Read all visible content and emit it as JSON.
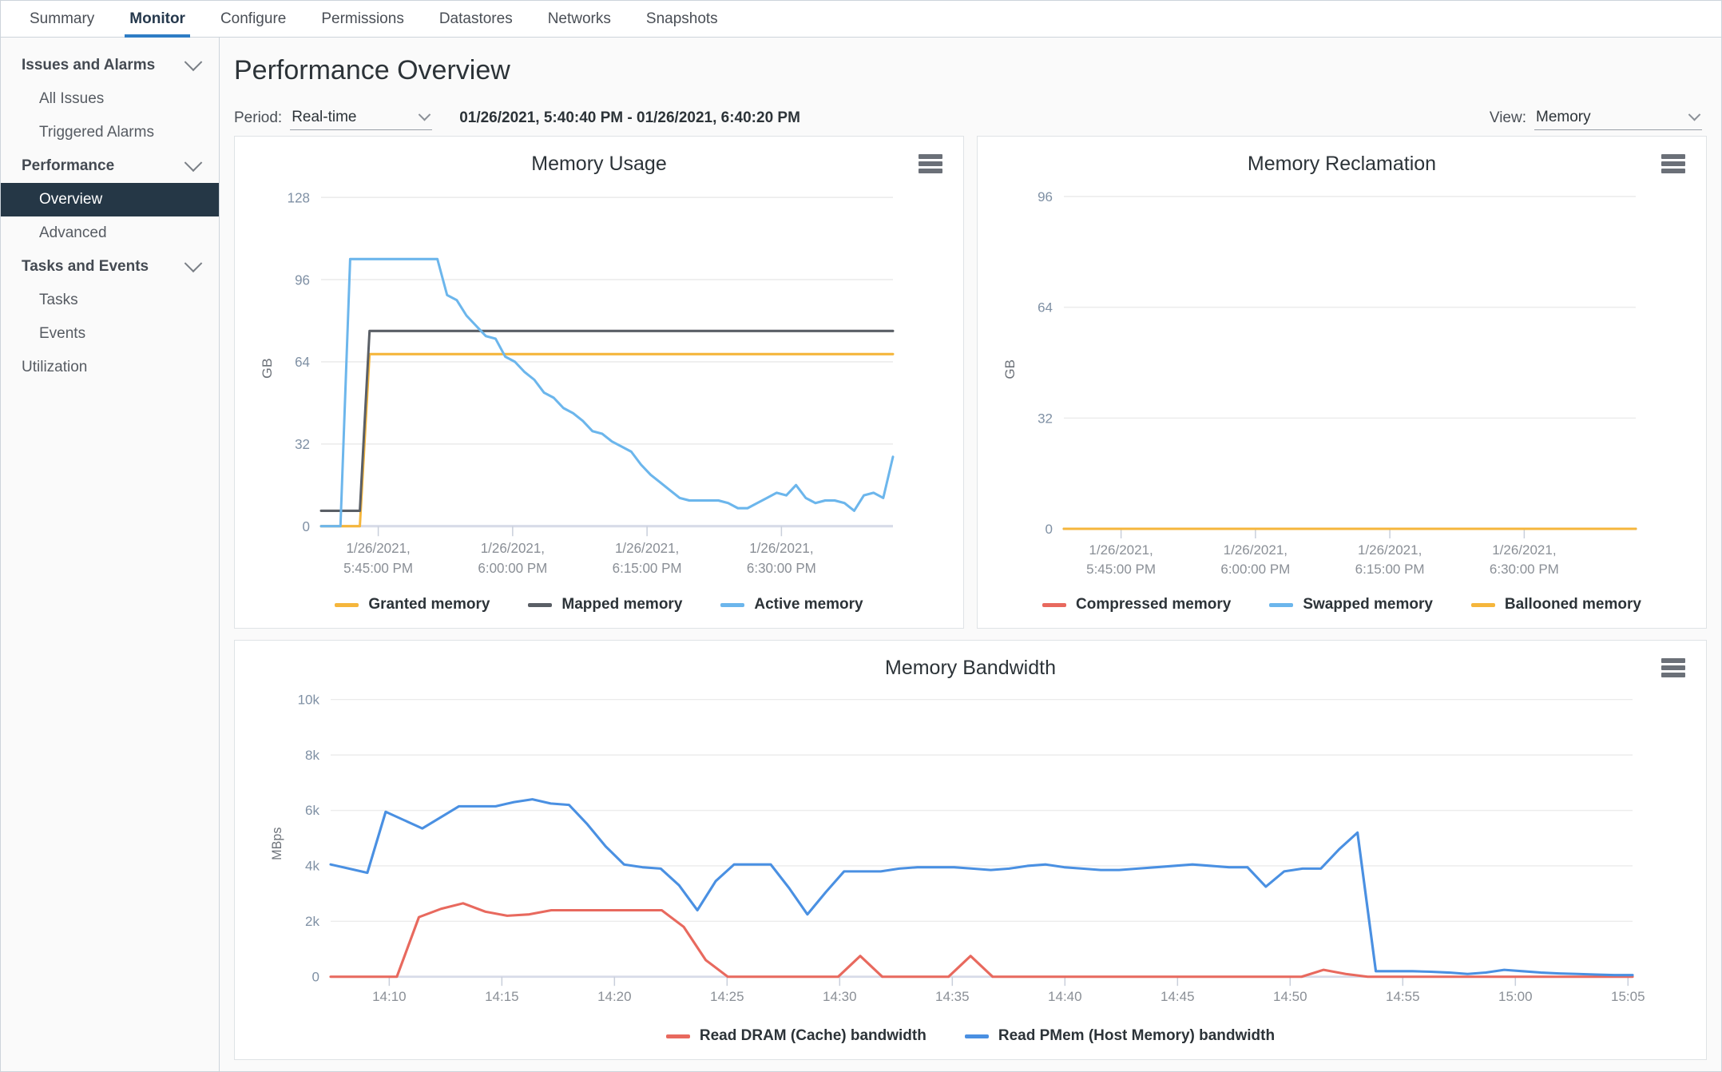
{
  "tabs": [
    {
      "label": "Summary",
      "active": false
    },
    {
      "label": "Monitor",
      "active": true
    },
    {
      "label": "Configure",
      "active": false
    },
    {
      "label": "Permissions",
      "active": false
    },
    {
      "label": "Datastores",
      "active": false
    },
    {
      "label": "Networks",
      "active": false
    },
    {
      "label": "Snapshots",
      "active": false
    }
  ],
  "sidebar": {
    "items": [
      {
        "label": "Issues and Alarms",
        "type": "group",
        "expanded": true
      },
      {
        "label": "All Issues",
        "type": "item"
      },
      {
        "label": "Triggered Alarms",
        "type": "item"
      },
      {
        "label": "Performance",
        "type": "group",
        "expanded": true
      },
      {
        "label": "Overview",
        "type": "item",
        "selected": true
      },
      {
        "label": "Advanced",
        "type": "item"
      },
      {
        "label": "Tasks and Events",
        "type": "group",
        "expanded": true
      },
      {
        "label": "Tasks",
        "type": "item"
      },
      {
        "label": "Events",
        "type": "item"
      },
      {
        "label": "Utilization",
        "type": "item-top"
      }
    ]
  },
  "header": {
    "title": "Performance Overview"
  },
  "controls": {
    "period_label": "Period:",
    "period_value": "Real-time",
    "range_text": "01/26/2021, 5:40:40 PM - 01/26/2021, 6:40:20 PM",
    "view_label": "View:",
    "view_value": "Memory"
  },
  "colors": {
    "granted_memory": "#f5b63c",
    "mapped_memory": "#5a5f66",
    "active_memory": "#6cb6ec",
    "compressed_memory": "#e8695e",
    "swapped_memory": "#6cb6ec",
    "ballooned_memory": "#f5b63c",
    "read_dram": "#e8695e",
    "read_pmem": "#4a90e2",
    "accent": "#2e7dc5",
    "selected_nav": "#253746"
  },
  "chart_data": [
    {
      "type": "line",
      "id": "memory-usage",
      "title": "Memory Usage",
      "xlabel": "",
      "ylabel": "GB",
      "ylim": [
        0,
        128
      ],
      "yticks": [
        0,
        32,
        64,
        96,
        128
      ],
      "ytick_labels": [
        "0",
        "32",
        "64",
        "96",
        "128"
      ],
      "xtick_labels": [
        "1/26/2021,\n5:45:00 PM",
        "1/26/2021,\n6:00:00 PM",
        "1/26/2021,\n6:15:00 PM",
        "1/26/2021,\n6:30:00 PM"
      ],
      "xticks": [
        "1/26/2021, 5:45:00 PM",
        "1/26/2021, 6:00:00 PM",
        "1/26/2021, 6:15:00 PM",
        "1/26/2021, 6:30:00 PM"
      ],
      "grid": true,
      "legend_position": "bottom",
      "series": [
        {
          "name": "Granted memory",
          "color": "#f5b63c",
          "values": [
            0,
            0,
            0,
            0,
            0,
            67,
            67,
            67,
            67,
            67,
            67,
            67,
            67,
            67,
            67,
            67,
            67,
            67,
            67,
            67,
            67,
            67,
            67,
            67,
            67,
            67,
            67,
            67,
            67,
            67,
            67,
            67,
            67,
            67,
            67,
            67,
            67,
            67,
            67,
            67,
            67,
            67,
            67,
            67,
            67,
            67,
            67,
            67,
            67,
            67,
            67,
            67,
            67,
            67,
            67,
            67,
            67,
            67,
            67,
            67
          ]
        },
        {
          "name": "Mapped memory",
          "color": "#5a5f66",
          "values": [
            6,
            6,
            6,
            6,
            6,
            76,
            76,
            76,
            76,
            76,
            76,
            76,
            76,
            76,
            76,
            76,
            76,
            76,
            76,
            76,
            76,
            76,
            76,
            76,
            76,
            76,
            76,
            76,
            76,
            76,
            76,
            76,
            76,
            76,
            76,
            76,
            76,
            76,
            76,
            76,
            76,
            76,
            76,
            76,
            76,
            76,
            76,
            76,
            76,
            76,
            76,
            76,
            76,
            76,
            76,
            76,
            76,
            76,
            76,
            76
          ]
        },
        {
          "name": "Active memory",
          "color": "#6cb6ec",
          "values": [
            0,
            0,
            0,
            104,
            104,
            104,
            104,
            104,
            104,
            104,
            104,
            104,
            104,
            90,
            88,
            82,
            78,
            74,
            73,
            66,
            64,
            60,
            57,
            52,
            50,
            46,
            44,
            41,
            37,
            36,
            33,
            31,
            29,
            24,
            20,
            17,
            14,
            11,
            10,
            10,
            10,
            10,
            9,
            7,
            7,
            9,
            11,
            13,
            12,
            16,
            11,
            9,
            10,
            10,
            9,
            6,
            12,
            13,
            11,
            27
          ]
        }
      ]
    },
    {
      "type": "line",
      "id": "memory-reclamation",
      "title": "Memory Reclamation",
      "xlabel": "",
      "ylabel": "GB",
      "ylim": [
        0,
        96
      ],
      "yticks": [
        0,
        32,
        64,
        96
      ],
      "ytick_labels": [
        "0",
        "32",
        "64",
        "96"
      ],
      "xtick_labels": [
        "1/26/2021,\n5:45:00 PM",
        "1/26/2021,\n6:00:00 PM",
        "1/26/2021,\n6:15:00 PM",
        "1/26/2021,\n6:30:00 PM"
      ],
      "xticks": [
        "1/26/2021, 5:45:00 PM",
        "1/26/2021, 6:00:00 PM",
        "1/26/2021, 6:15:00 PM",
        "1/26/2021, 6:30:00 PM"
      ],
      "grid": true,
      "legend_position": "bottom",
      "series": [
        {
          "name": "Compressed memory",
          "color": "#e8695e",
          "values": [
            0,
            0,
            0,
            0,
            0,
            0,
            0,
            0,
            0,
            0,
            0,
            0,
            0,
            0,
            0,
            0,
            0,
            0,
            0,
            0,
            0,
            0,
            0,
            0,
            0,
            0,
            0,
            0,
            0,
            0,
            0,
            0,
            0,
            0,
            0,
            0,
            0,
            0,
            0,
            0,
            0,
            0,
            0,
            0,
            0,
            0,
            0,
            0,
            0,
            0,
            0,
            0,
            0,
            0,
            0,
            0,
            0,
            0,
            0,
            0
          ]
        },
        {
          "name": "Swapped memory",
          "color": "#6cb6ec",
          "values": [
            0,
            0,
            0,
            0,
            0,
            0,
            0,
            0,
            0,
            0,
            0,
            0,
            0,
            0,
            0,
            0,
            0,
            0,
            0,
            0,
            0,
            0,
            0,
            0,
            0,
            0,
            0,
            0,
            0,
            0,
            0,
            0,
            0,
            0,
            0,
            0,
            0,
            0,
            0,
            0,
            0,
            0,
            0,
            0,
            0,
            0,
            0,
            0,
            0,
            0,
            0,
            0,
            0,
            0,
            0,
            0,
            0,
            0,
            0,
            0
          ]
        },
        {
          "name": "Ballooned memory",
          "color": "#f5b63c",
          "values": [
            0,
            0,
            0,
            0,
            0,
            0,
            0,
            0,
            0,
            0,
            0,
            0,
            0,
            0,
            0,
            0,
            0,
            0,
            0,
            0,
            0,
            0,
            0,
            0,
            0,
            0,
            0,
            0,
            0,
            0,
            0,
            0,
            0,
            0,
            0,
            0,
            0,
            0,
            0,
            0,
            0,
            0,
            0,
            0,
            0,
            0,
            0,
            0,
            0,
            0,
            0,
            0,
            0,
            0,
            0,
            0,
            0,
            0,
            0,
            0
          ]
        }
      ]
    },
    {
      "type": "line",
      "id": "memory-bandwidth",
      "title": "Memory Bandwidth",
      "xlabel": "",
      "ylabel": "MBps",
      "ylim": [
        0,
        10000
      ],
      "yticks": [
        0,
        2000,
        4000,
        6000,
        8000,
        10000
      ],
      "ytick_labels": [
        "0",
        "2k",
        "4k",
        "6k",
        "8k",
        "10k"
      ],
      "xticks": [
        "14:10",
        "14:15",
        "14:20",
        "14:25",
        "14:30",
        "14:35",
        "14:40",
        "14:45",
        "14:50",
        "14:55",
        "15:00",
        "15:05"
      ],
      "grid": true,
      "legend_position": "bottom",
      "series": [
        {
          "name": "Read DRAM (Cache) bandwidth",
          "color": "#e8695e",
          "values": [
            0,
            0,
            0,
            0,
            2150,
            2450,
            2650,
            2350,
            2200,
            2250,
            2400,
            2400,
            2400,
            2400,
            2400,
            2400,
            1800,
            600,
            0,
            0,
            0,
            0,
            0,
            0,
            750,
            0,
            0,
            0,
            0,
            750,
            0,
            0,
            0,
            0,
            0,
            0,
            0,
            0,
            0,
            0,
            0,
            0,
            0,
            0,
            0,
            250,
            100,
            0,
            0,
            0,
            0,
            0,
            0,
            0,
            0,
            0,
            0,
            0,
            0,
            0
          ]
        },
        {
          "name": "Read PMem (Host Memory) bandwidth",
          "color": "#4a90e2",
          "values": [
            4050,
            3900,
            3750,
            5950,
            5650,
            5350,
            5750,
            6150,
            6150,
            6150,
            6300,
            6400,
            6250,
            6200,
            5500,
            4700,
            4050,
            3950,
            3900,
            3300,
            2400,
            3450,
            4050,
            4050,
            4050,
            3200,
            2250,
            3050,
            3800,
            3800,
            3800,
            3900,
            3950,
            3950,
            3950,
            3900,
            3850,
            3900,
            4000,
            4050,
            3950,
            3900,
            3850,
            3850,
            3900,
            3950,
            4000,
            4050,
            4000,
            3950,
            3950,
            3250,
            3800,
            3900,
            3900,
            4600,
            5200,
            200,
            200,
            200,
            180,
            150,
            100,
            150,
            250,
            200,
            150,
            120,
            100,
            80,
            60,
            60
          ]
        }
      ]
    }
  ],
  "icons": {
    "hamburger": "hamburger-menu-icon",
    "chevron_down": "chevron-down-icon"
  }
}
